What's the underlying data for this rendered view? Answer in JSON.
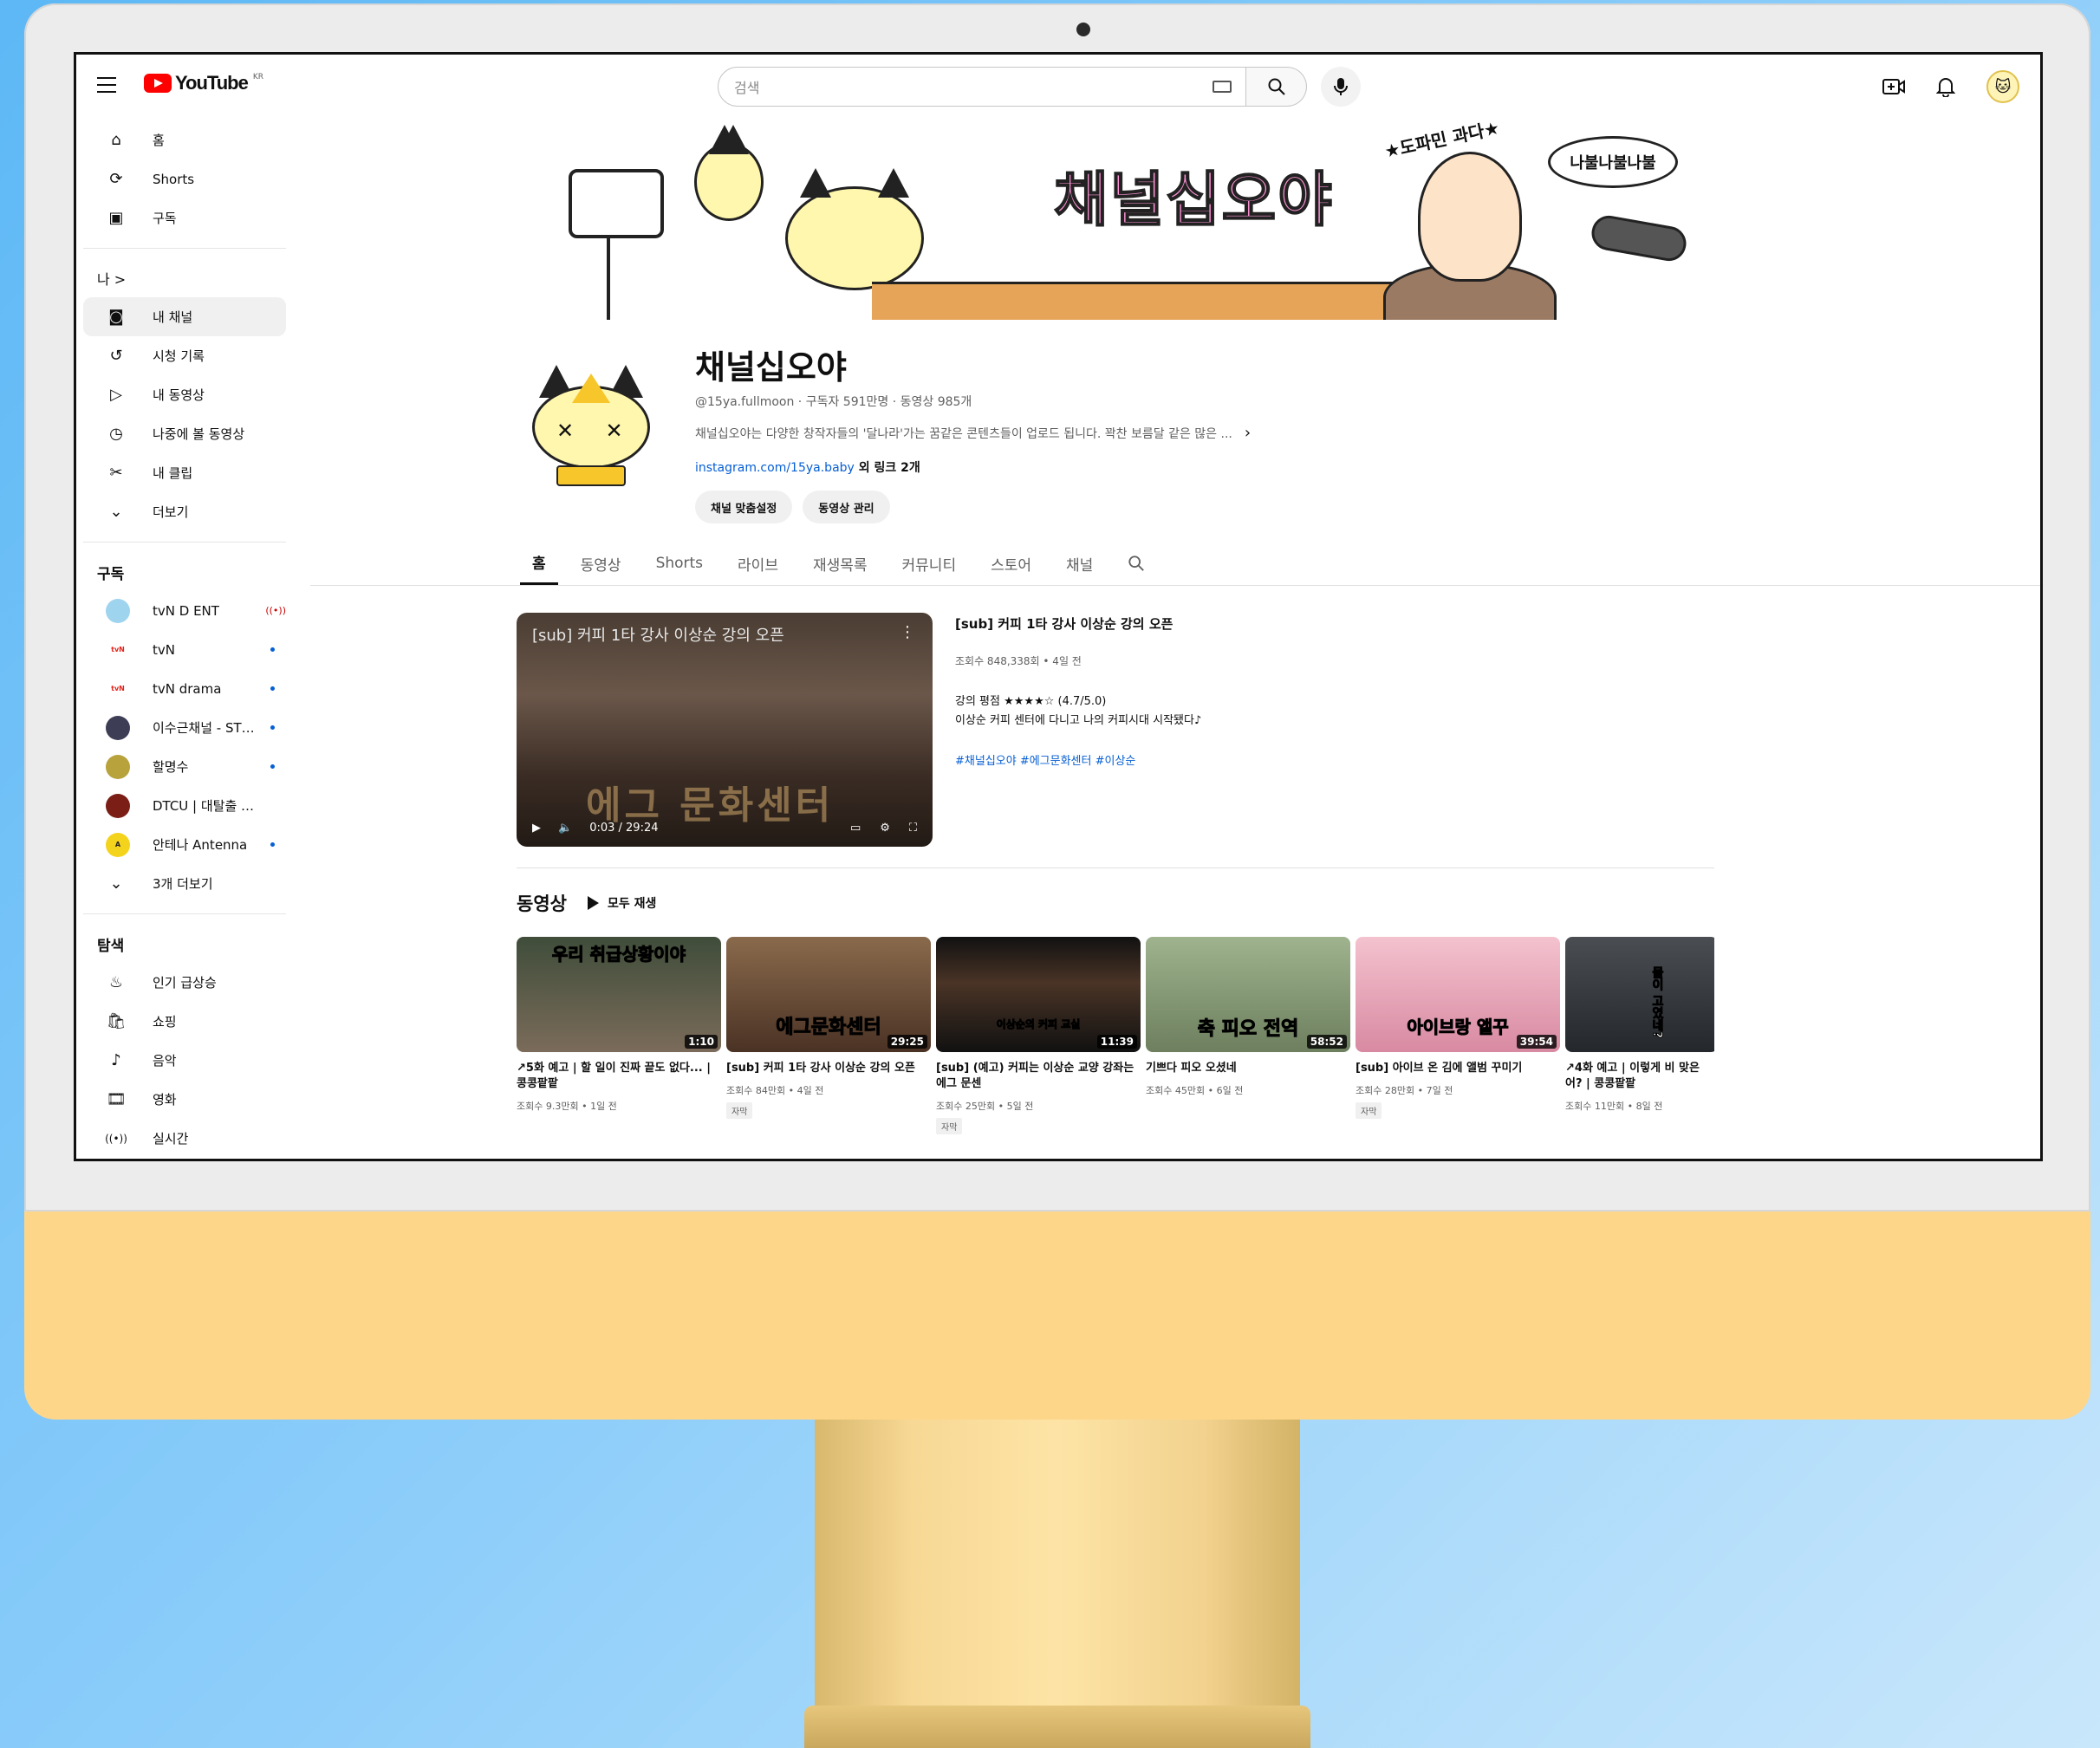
{
  "topbar": {
    "logo_text": "YouTube",
    "logo_country": "KR",
    "search_placeholder": "검색"
  },
  "sidebar": {
    "main": [
      {
        "label": "홈",
        "icon": "home-icon"
      },
      {
        "label": "Shorts",
        "icon": "shorts-icon"
      },
      {
        "label": "구독",
        "icon": "subscriptions-icon"
      }
    ],
    "you_heading": "나 >",
    "you": [
      {
        "label": "내 채널",
        "icon": "channel-icon"
      },
      {
        "label": "시청 기록",
        "icon": "history-icon"
      },
      {
        "label": "내 동영상",
        "icon": "my-videos-icon"
      },
      {
        "label": "나중에 볼 동영상",
        "icon": "watch-later-icon"
      },
      {
        "label": "내 클립",
        "icon": "clips-icon"
      },
      {
        "label": "더보기",
        "icon": "chevron-down-icon"
      }
    ],
    "subs_heading": "구독",
    "subs": [
      {
        "name": "tvN D ENT",
        "status": "live",
        "color": "#9fd4ef"
      },
      {
        "name": "tvN",
        "status": "dot",
        "color": "#e62117"
      },
      {
        "name": "tvN drama",
        "status": "dot",
        "color": "#e62117"
      },
      {
        "name": "이수근채널 - STUDIO",
        "status": "dot",
        "color": "#3d3d55"
      },
      {
        "name": "할명수",
        "status": "dot",
        "color": "#b8a23c"
      },
      {
        "name": "DTCU | 대탈출 유니버스",
        "status": "none",
        "color": "#7a1e16"
      },
      {
        "name": "안테나 Antenna",
        "status": "dot",
        "color": "#f4d31c"
      }
    ],
    "subs_more": "3개 더보기",
    "explore_heading": "탐색",
    "explore": [
      {
        "label": "인기 급상승",
        "icon": "trending-icon"
      },
      {
        "label": "쇼핑",
        "icon": "shopping-icon"
      },
      {
        "label": "음악",
        "icon": "music-icon"
      },
      {
        "label": "영화",
        "icon": "movie-icon"
      },
      {
        "label": "실시간",
        "icon": "live-icon"
      }
    ]
  },
  "banner": {
    "title": "채널십오야",
    "tag": "★도파민 과다★",
    "bubble": "나불나불나불"
  },
  "channel": {
    "name": "채널십오야",
    "meta": "@15ya.fullmoon · 구독자 591만명 · 동영상 985개",
    "description": "채널십오야는 다양한 창작자들의 '달나라'가는 꿈같은 콘텐츠들이 업로드 됩니다. 꽉찬 보름달 같은 많은 ...",
    "link": "instagram.com/15ya.baby",
    "link_more": " 외 링크 2개",
    "customize_button": "채널 맞춤설정",
    "manage_button": "동영상 관리"
  },
  "tabs": [
    "홈",
    "동영상",
    "Shorts",
    "라이브",
    "재생목록",
    "커뮤니티",
    "스토어",
    "채널"
  ],
  "featured": {
    "overlay_title": "[sub] 커피 1타 강사 이상순 강의 오픈",
    "watermark": "에그 문화센터",
    "time": "0:03 / 29:24",
    "title": "[sub] 커피 1타 강사 이상순 강의 오픈",
    "meta": "조회수 848,338회 • 4일 전",
    "desc_line1": "강의 평점 ★★★★☆ (4.7/5.0)",
    "desc_line2": "이상순 커피 센터에 다니고 나의 커피시대 시작됐다♪",
    "tags": "#채널십오야 #에그문화센터 #이상순"
  },
  "videos": {
    "title": "동영상",
    "play_all": "모두 재생",
    "items": [
      {
        "title": "↗5화 예고 | 할 일이 진짜 끝도 없다... | 콩콩팥팥",
        "meta": "조회수 9.3만회 • 1일 전",
        "duration": "1:10",
        "overlay": "우리 취급상황이야",
        "badge": "",
        "bg": "#3f4d3a"
      },
      {
        "title": "[sub] 커피 1타 강사 이상순 강의 오픈",
        "meta": "조회수 84만회 • 4일 전",
        "duration": "29:25",
        "overlay": "에그문화센터",
        "badge": "자막",
        "bg": "#6b4a32"
      },
      {
        "title": "[sub] (예고) 커피는 이상순 교양 강좌는 에그 문센",
        "meta": "조회수 25만회 • 5일 전",
        "duration": "11:39",
        "overlay": "이상순의 커피 교실",
        "badge": "자막",
        "bg": "#2a1f1a"
      },
      {
        "title": "기쁘다 피오 오셨네",
        "meta": "조회수 45만회 • 6일 전",
        "duration": "58:52",
        "overlay": "축 피오 전역",
        "badge": "",
        "bg": "#7b8f73"
      },
      {
        "title": "[sub] 아이브 온 김에 앨범 꾸미기",
        "meta": "조회수 28만회 • 7일 전",
        "duration": "39:54",
        "overlay": "아이브랑 앨꾸",
        "badge": "자막",
        "bg": "#e8a6b8"
      },
      {
        "title": "↗4화 예고 | 이렇게 비 맞은 어? | 콩콩팥팥",
        "meta": "조회수 11만회 • 8일 전",
        "duration": "",
        "overlay": "물이 고였네?",
        "badge": "",
        "bg": "#3a3e42"
      }
    ]
  }
}
